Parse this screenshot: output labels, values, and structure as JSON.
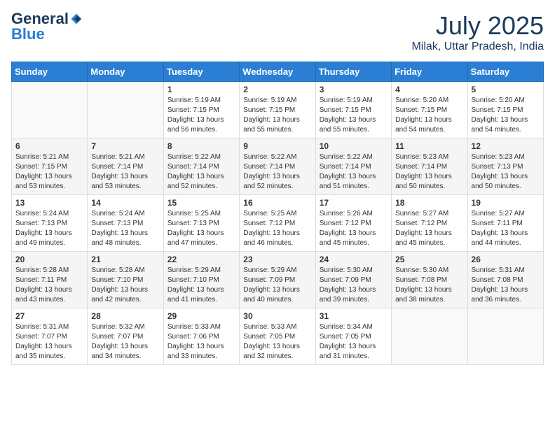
{
  "header": {
    "logo_general": "General",
    "logo_blue": "Blue",
    "month_title": "July 2025",
    "location": "Milak, Uttar Pradesh, India"
  },
  "days_of_week": [
    "Sunday",
    "Monday",
    "Tuesday",
    "Wednesday",
    "Thursday",
    "Friday",
    "Saturday"
  ],
  "weeks": [
    [
      {
        "day": "",
        "content": ""
      },
      {
        "day": "",
        "content": ""
      },
      {
        "day": "1",
        "content": "Sunrise: 5:19 AM\nSunset: 7:15 PM\nDaylight: 13 hours and 56 minutes."
      },
      {
        "day": "2",
        "content": "Sunrise: 5:19 AM\nSunset: 7:15 PM\nDaylight: 13 hours and 55 minutes."
      },
      {
        "day": "3",
        "content": "Sunrise: 5:19 AM\nSunset: 7:15 PM\nDaylight: 13 hours and 55 minutes."
      },
      {
        "day": "4",
        "content": "Sunrise: 5:20 AM\nSunset: 7:15 PM\nDaylight: 13 hours and 54 minutes."
      },
      {
        "day": "5",
        "content": "Sunrise: 5:20 AM\nSunset: 7:15 PM\nDaylight: 13 hours and 54 minutes."
      }
    ],
    [
      {
        "day": "6",
        "content": "Sunrise: 5:21 AM\nSunset: 7:15 PM\nDaylight: 13 hours and 53 minutes."
      },
      {
        "day": "7",
        "content": "Sunrise: 5:21 AM\nSunset: 7:14 PM\nDaylight: 13 hours and 53 minutes."
      },
      {
        "day": "8",
        "content": "Sunrise: 5:22 AM\nSunset: 7:14 PM\nDaylight: 13 hours and 52 minutes."
      },
      {
        "day": "9",
        "content": "Sunrise: 5:22 AM\nSunset: 7:14 PM\nDaylight: 13 hours and 52 minutes."
      },
      {
        "day": "10",
        "content": "Sunrise: 5:22 AM\nSunset: 7:14 PM\nDaylight: 13 hours and 51 minutes."
      },
      {
        "day": "11",
        "content": "Sunrise: 5:23 AM\nSunset: 7:14 PM\nDaylight: 13 hours and 50 minutes."
      },
      {
        "day": "12",
        "content": "Sunrise: 5:23 AM\nSunset: 7:13 PM\nDaylight: 13 hours and 50 minutes."
      }
    ],
    [
      {
        "day": "13",
        "content": "Sunrise: 5:24 AM\nSunset: 7:13 PM\nDaylight: 13 hours and 49 minutes."
      },
      {
        "day": "14",
        "content": "Sunrise: 5:24 AM\nSunset: 7:13 PM\nDaylight: 13 hours and 48 minutes."
      },
      {
        "day": "15",
        "content": "Sunrise: 5:25 AM\nSunset: 7:13 PM\nDaylight: 13 hours and 47 minutes."
      },
      {
        "day": "16",
        "content": "Sunrise: 5:25 AM\nSunset: 7:12 PM\nDaylight: 13 hours and 46 minutes."
      },
      {
        "day": "17",
        "content": "Sunrise: 5:26 AM\nSunset: 7:12 PM\nDaylight: 13 hours and 45 minutes."
      },
      {
        "day": "18",
        "content": "Sunrise: 5:27 AM\nSunset: 7:12 PM\nDaylight: 13 hours and 45 minutes."
      },
      {
        "day": "19",
        "content": "Sunrise: 5:27 AM\nSunset: 7:11 PM\nDaylight: 13 hours and 44 minutes."
      }
    ],
    [
      {
        "day": "20",
        "content": "Sunrise: 5:28 AM\nSunset: 7:11 PM\nDaylight: 13 hours and 43 minutes."
      },
      {
        "day": "21",
        "content": "Sunrise: 5:28 AM\nSunset: 7:10 PM\nDaylight: 13 hours and 42 minutes."
      },
      {
        "day": "22",
        "content": "Sunrise: 5:29 AM\nSunset: 7:10 PM\nDaylight: 13 hours and 41 minutes."
      },
      {
        "day": "23",
        "content": "Sunrise: 5:29 AM\nSunset: 7:09 PM\nDaylight: 13 hours and 40 minutes."
      },
      {
        "day": "24",
        "content": "Sunrise: 5:30 AM\nSunset: 7:09 PM\nDaylight: 13 hours and 39 minutes."
      },
      {
        "day": "25",
        "content": "Sunrise: 5:30 AM\nSunset: 7:08 PM\nDaylight: 13 hours and 38 minutes."
      },
      {
        "day": "26",
        "content": "Sunrise: 5:31 AM\nSunset: 7:08 PM\nDaylight: 13 hours and 36 minutes."
      }
    ],
    [
      {
        "day": "27",
        "content": "Sunrise: 5:31 AM\nSunset: 7:07 PM\nDaylight: 13 hours and 35 minutes."
      },
      {
        "day": "28",
        "content": "Sunrise: 5:32 AM\nSunset: 7:07 PM\nDaylight: 13 hours and 34 minutes."
      },
      {
        "day": "29",
        "content": "Sunrise: 5:33 AM\nSunset: 7:06 PM\nDaylight: 13 hours and 33 minutes."
      },
      {
        "day": "30",
        "content": "Sunrise: 5:33 AM\nSunset: 7:05 PM\nDaylight: 13 hours and 32 minutes."
      },
      {
        "day": "31",
        "content": "Sunrise: 5:34 AM\nSunset: 7:05 PM\nDaylight: 13 hours and 31 minutes."
      },
      {
        "day": "",
        "content": ""
      },
      {
        "day": "",
        "content": ""
      }
    ]
  ]
}
